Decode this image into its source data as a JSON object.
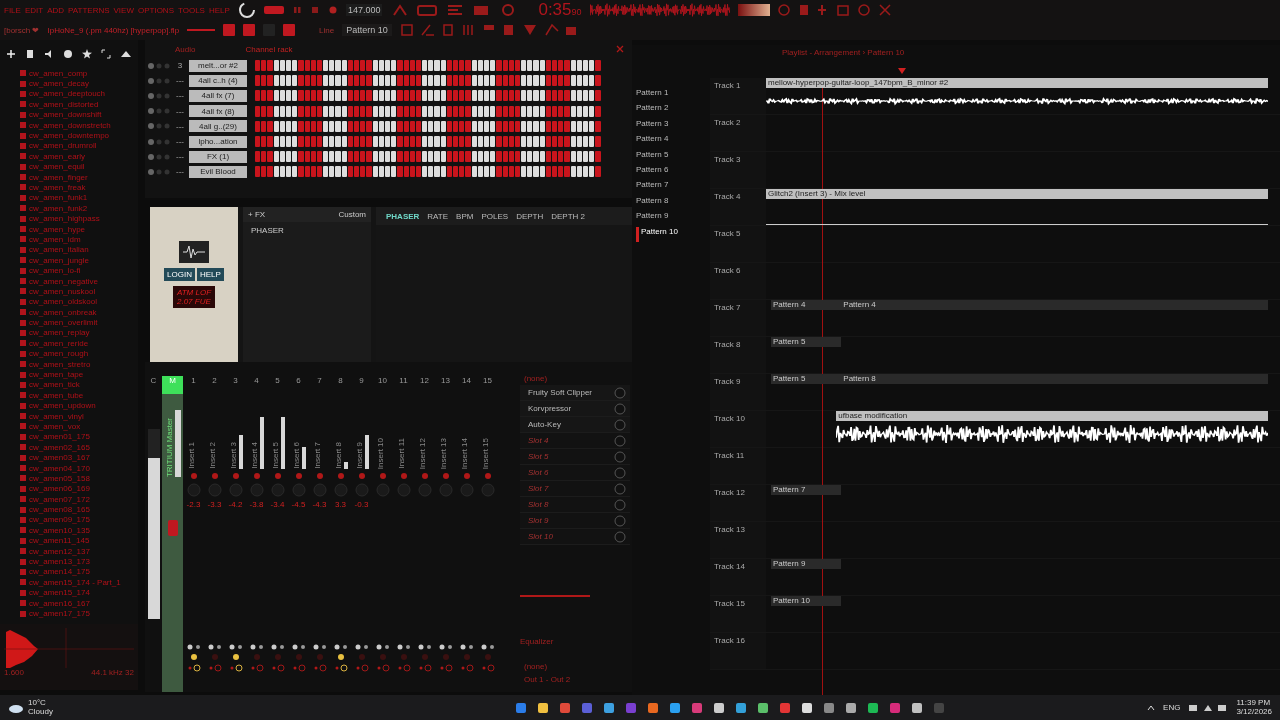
{
  "menu": [
    "FILE",
    "EDIT",
    "ADD",
    "PATTERNS",
    "VIEW",
    "OPTIONS",
    "TOOLS",
    "HELP"
  ],
  "transport": {
    "tempo": "147.000",
    "time": "0:35",
    "time_sub": "90",
    "playing": false,
    "pattern_mode": true
  },
  "project": {
    "user": "[borsch ❤",
    "title": "IpHoNe_9 (.pm 440hz) [hyperpop].flp",
    "snap": "Line",
    "pattern": "Pattern 10"
  },
  "browser": {
    "items": [
      "cw_amen_comp",
      "cw_amen_decay",
      "cw_amen_deeptouch",
      "cw_amen_distorted",
      "cw_amen_downshift",
      "cw_amen_downstretch",
      "cw_amen_downtempo",
      "cw_amen_drumroll",
      "cw_amen_early",
      "cw_amen_equil",
      "cw_amen_finger",
      "cw_amen_freak",
      "cw_amen_funk1",
      "cw_amen_funk2",
      "cw_amen_highpass",
      "cw_amen_hype",
      "cw_amen_idm",
      "cw_amen_italian",
      "cw_amen_jungle",
      "cw_amen_lo-fi",
      "cw_amen_negative",
      "cw_amen_nuskool",
      "cw_amen_oldskool",
      "cw_amen_onbreak",
      "cw_amen_overlimit",
      "cw_amen_replay",
      "cw_amen_reride",
      "cw_amen_rough",
      "cw_amen_stretro",
      "cw_amen_tape",
      "cw_amen_tick",
      "cw_amen_tube",
      "cw_amen_updown",
      "cw_amen_vinyl",
      "cw_amen_vox",
      "cw_amen01_175",
      "cw_amen02_165",
      "cw_amen03_167",
      "cw_amen04_170",
      "cw_amen05_158",
      "cw_amen06_169",
      "cw_amen07_172",
      "cw_amen08_165",
      "cw_amen09_175",
      "cw_amen10_135",
      "cw_amen11_145",
      "cw_amen12_137",
      "cw_amen13_173",
      "cw_amen14_175",
      "cw_amen15_174 - Part_1",
      "cw_amen15_174",
      "cw_amen16_167",
      "cw_amen17_175"
    ],
    "sample_info": "44.1 kHz 32",
    "sample_length": "1.600"
  },
  "channel_rack": {
    "title": "Channel rack",
    "group": "Audio",
    "channels": [
      {
        "name": "melt...or #2",
        "number": "3"
      },
      {
        "name": "4all c..h (4)",
        "number": "---"
      },
      {
        "name": "4all fx (7)",
        "number": "---"
      },
      {
        "name": "4all fx (8)",
        "number": "---"
      },
      {
        "name": "4all g..(29)",
        "number": "---"
      },
      {
        "name": "lpho...ation",
        "number": "---"
      },
      {
        "name": "FX (1)",
        "number": "---"
      },
      {
        "name": "Evil Blood",
        "number": "---"
      }
    ]
  },
  "plugin": {
    "buttons": [
      "LOGIN",
      "HELP"
    ],
    "display": [
      "ATM LOF",
      "2.07 FUE"
    ]
  },
  "fx_panel": {
    "add": "+ FX",
    "preset": "Custom",
    "effect": "PHASER",
    "logo": "PHASER",
    "knobs": [
      "RATE",
      "BPM",
      "POLES",
      "DEPTH",
      "DEPTH 2"
    ]
  },
  "mixer": {
    "current": {
      "label": "C"
    },
    "master": {
      "number": "M",
      "label": "TRITIUM Master"
    },
    "inserts": [
      {
        "number": "1",
        "label": "Insert 1",
        "value": "-2.3",
        "send": true
      },
      {
        "number": "2",
        "label": "Insert 2",
        "value": "-3.3",
        "send": false
      },
      {
        "number": "3",
        "label": "Insert 3",
        "value": "-4.2",
        "send": true
      },
      {
        "number": "4",
        "label": "Insert 4",
        "value": "-3.8",
        "send": false
      },
      {
        "number": "5",
        "label": "Insert 5",
        "value": "-3.4",
        "send": false
      },
      {
        "number": "6",
        "label": "Insert 6",
        "value": "-4.5",
        "send": false
      },
      {
        "number": "7",
        "label": "Insert 7",
        "value": "-4.3",
        "send": false
      },
      {
        "number": "8",
        "label": "Insert 8",
        "value": "3.3",
        "send": true
      },
      {
        "number": "9",
        "label": "Insert 9",
        "value": "-0.3",
        "send": false
      },
      {
        "number": "10",
        "label": "Insert 10",
        "send": false
      },
      {
        "number": "11",
        "label": "Insert 11",
        "send": false
      },
      {
        "number": "12",
        "label": "Insert 12",
        "send": false
      },
      {
        "number": "13",
        "label": "Insert 13",
        "send": false
      },
      {
        "number": "14",
        "label": "Insert 14",
        "send": false
      },
      {
        "number": "15",
        "label": "Insert 15",
        "send": false
      }
    ],
    "input": "(none)",
    "slots": [
      {
        "name": "Fruity Soft Clipper",
        "kind": "plugin"
      },
      {
        "name": "Korvpressor",
        "kind": "plugin"
      },
      {
        "name": "Auto-Key",
        "kind": "plugin"
      },
      {
        "name": "Slot 4",
        "kind": "empty"
      },
      {
        "name": "Slot 5",
        "kind": "empty"
      },
      {
        "name": "Slot 6",
        "kind": "empty"
      },
      {
        "name": "Slot 7",
        "kind": "empty"
      },
      {
        "name": "Slot 8",
        "kind": "empty"
      },
      {
        "name": "Slot 9",
        "kind": "empty"
      },
      {
        "name": "Slot 10",
        "kind": "empty"
      }
    ],
    "eq": "Equalizer",
    "output_in": "(none)",
    "output": "Out 1 - Out 2"
  },
  "playlist": {
    "title": "Playlist - Arrangement › Pattern 10",
    "patterns": [
      {
        "name": "Pattern 1",
        "selected": false
      },
      {
        "name": "Pattern 2",
        "selected": false
      },
      {
        "name": "Pattern 3",
        "selected": false
      },
      {
        "name": "Pattern 4",
        "selected": false
      },
      {
        "name": "Pattern 5",
        "selected": false
      },
      {
        "name": "Pattern 6",
        "selected": false
      },
      {
        "name": "Pattern 7",
        "selected": false
      },
      {
        "name": "Pattern 8",
        "selected": false
      },
      {
        "name": "Pattern 9",
        "selected": false
      },
      {
        "name": "Pattern 10",
        "selected": true
      }
    ],
    "tracks": [
      {
        "name": "Track 1",
        "clips": [
          {
            "kind": "audio",
            "label": "mellow-hyperpop-guitar-loop_147bpm_B_minor #2"
          }
        ]
      },
      {
        "name": "Track 2"
      },
      {
        "name": "Track 3"
      },
      {
        "name": "Track 4",
        "clips": [
          {
            "kind": "automation",
            "label": "Glitch2 (Insert 3) - Mix level"
          }
        ]
      },
      {
        "name": "Track 5"
      },
      {
        "name": "Track 6"
      },
      {
        "name": "Track 7",
        "clips": [
          {
            "kind": "pattern",
            "label": "Pattern 4"
          },
          {
            "kind": "pattern",
            "label": "Pattern 4"
          }
        ]
      },
      {
        "name": "Track 8",
        "clips": [
          {
            "kind": "pattern",
            "label": "Pattern 5"
          }
        ]
      },
      {
        "name": "Track 9",
        "clips": [
          {
            "kind": "pattern",
            "label": "Pattern 5"
          },
          {
            "kind": "pattern",
            "label": "Pattern 8"
          }
        ]
      },
      {
        "name": "Track 10",
        "clips": [
          {
            "kind": "audio",
            "label": "ufbase modification"
          }
        ]
      },
      {
        "name": "Track 11"
      },
      {
        "name": "Track 12",
        "clips": [
          {
            "kind": "pattern",
            "label": "Pattern 7"
          }
        ]
      },
      {
        "name": "Track 13"
      },
      {
        "name": "Track 14",
        "clips": [
          {
            "kind": "pattern",
            "label": "Pattern 9"
          }
        ]
      },
      {
        "name": "Track 15",
        "clips": [
          {
            "kind": "pattern",
            "label": "Pattern 10"
          }
        ]
      },
      {
        "name": "Track 16"
      }
    ]
  },
  "taskbar": {
    "temperature": "10°C",
    "weather": "Cloudy",
    "language": "ENG",
    "time": "11:39 PM",
    "date": "3/12/2026"
  }
}
